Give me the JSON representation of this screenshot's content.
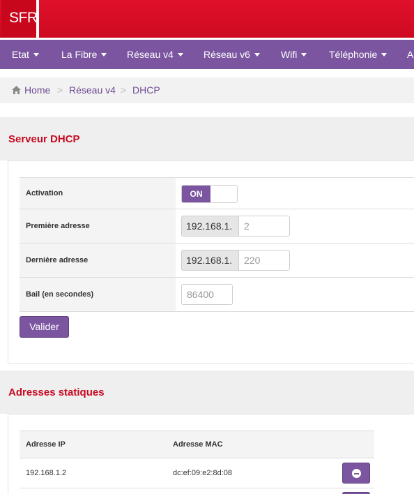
{
  "header": {
    "logo_text": "SFR",
    "brand_color": "#d5081f"
  },
  "nav": {
    "accent": "#7b55a0",
    "items": [
      {
        "label": "Etat"
      },
      {
        "label": "La Fibre"
      },
      {
        "label": "Réseau v4"
      },
      {
        "label": "Réseau v6"
      },
      {
        "label": "Wifi"
      },
      {
        "label": "Téléphonie"
      },
      {
        "label": "A"
      }
    ]
  },
  "breadcrumb": {
    "icon": "home-icon",
    "items": [
      "Home",
      "Réseau v4",
      "DHCP"
    ],
    "separator": ">"
  },
  "dhcp": {
    "title": "Serveur DHCP",
    "activation_label": "Activation",
    "toggle_on": "ON",
    "first_label": "Première adresse",
    "first_prefix": "192.168.1.",
    "first_value": "2",
    "last_label": "Dernière adresse",
    "last_prefix": "192.168.1.",
    "last_value": "220",
    "lease_label": "Bail (en secondes)",
    "lease_value": "86400",
    "submit_label": "Valider"
  },
  "static": {
    "title": "Adresses statiques",
    "col_ip": "Adresse IP",
    "col_mac": "Adresse MAC",
    "rows": [
      {
        "ip": "192.168.1.2",
        "mac": "dc:ef:09:e2:8d:08"
      }
    ]
  }
}
